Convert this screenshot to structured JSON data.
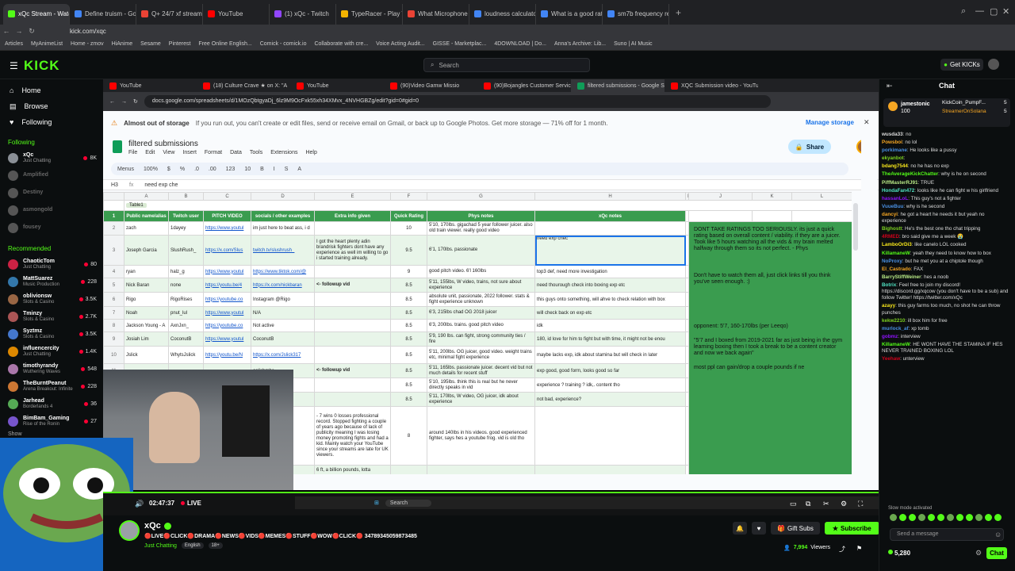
{
  "browser": {
    "tabs": [
      {
        "label": "xQc Stream - Watch Li",
        "color": "#53fc18",
        "active": true
      },
      {
        "label": "Define truism - Google S",
        "color": "#4285f4"
      },
      {
        "label": "Q+ 24/7 xf stream in Ame",
        "color": "#ea4335"
      },
      {
        "label": "YouTube",
        "color": "#ff0000"
      },
      {
        "label": "(1) xQc - Twitch",
        "color": "#9146ff"
      },
      {
        "label": "TypeRacer - Play Typing G",
        "color": "#f4b400"
      },
      {
        "label": "What Microphone Does R",
        "color": "#ea4335"
      },
      {
        "label": "loudness calculator file -",
        "color": "#4285f4"
      },
      {
        "label": "What is a good ratio for v",
        "color": "#4285f4"
      },
      {
        "label": "sm7b frequency response",
        "color": "#4285f4"
      }
    ],
    "url": "kick.com/xqc",
    "bookmarks": [
      "Articles",
      "MyAnimeList",
      "Home - zmov",
      "HiAnime",
      "Sesame",
      "Pinterest",
      "Free Online English...",
      "Comick - comick.io",
      "Collaborate with cre...",
      "Voice Acting Audit...",
      "GISSE - Marketplac...",
      "4DOWNLOAD | Do...",
      "Anna's Archive: Lib...",
      "Suno | AI Music"
    ]
  },
  "kick": {
    "logo": "KICK",
    "search_placeholder": "Search",
    "get_kicks": "Get KICKs"
  },
  "sidebar": {
    "nav": [
      {
        "label": "Home",
        "icon": "home-icon"
      },
      {
        "label": "Browse",
        "icon": "browse-icon"
      },
      {
        "label": "Following",
        "icon": "heart-icon"
      }
    ],
    "following_heading": "Following",
    "following": [
      {
        "name": "xQc",
        "cat": "Just Chatting",
        "viewers": "8K",
        "color": "#8a8f96",
        "live": true
      },
      {
        "name": "Amplified",
        "cat": "",
        "viewers": "",
        "color": "#555",
        "live": false
      },
      {
        "name": "Destiny",
        "cat": "",
        "viewers": "",
        "color": "#555",
        "live": false
      },
      {
        "name": "asmongold",
        "cat": "",
        "viewers": "",
        "color": "#555",
        "live": false
      },
      {
        "name": "fousey",
        "cat": "",
        "viewers": "",
        "color": "#555",
        "live": false
      }
    ],
    "recommended_heading": "Recommended",
    "recommended": [
      {
        "name": "ChaoticTom",
        "cat": "Just Chatting",
        "viewers": "80",
        "color": "#c24"
      },
      {
        "name": "MattSuarez",
        "cat": "Music Production",
        "viewers": "228",
        "color": "#37a"
      },
      {
        "name": "oblivionsw",
        "cat": "Slots & Casino",
        "viewers": "3.5K",
        "color": "#964"
      },
      {
        "name": "Tminzy",
        "cat": "Slots & Casino",
        "viewers": "2.7K",
        "color": "#a55"
      },
      {
        "name": "Syztmz",
        "cat": "Slots & Casino",
        "viewers": "3.5K",
        "color": "#47c"
      },
      {
        "name": "influencercity",
        "cat": "Just Chatting",
        "viewers": "1.4K",
        "color": "#d80"
      },
      {
        "name": "timothyrandy",
        "cat": "Wuthering Waves",
        "viewers": "548",
        "color": "#a7a"
      },
      {
        "name": "TheBurntPeanut",
        "cat": "Arena Breakout: Infinite",
        "viewers": "228",
        "color": "#c73"
      },
      {
        "name": "Jarhead",
        "cat": "Borderlands 4",
        "viewers": "36",
        "color": "#5a5"
      },
      {
        "name": "BimBam_Gaming",
        "cat": "Rise of the Ronin",
        "viewers": "27",
        "color": "#75c"
      }
    ],
    "show_more": "Show"
  },
  "inner_browser": {
    "tabs": [
      "YouTube",
      "(18) Culture Crave ★ on X: \"A",
      "YouTube",
      "(90)Video Gamw Missio",
      "(90)Bojangles Customer Servic",
      "filtered submissions - Google S",
      "XQC Submission video - YouTu"
    ],
    "url": "docs.google.com/spreadsheets/d/1MOzQbtgyaDj_6lz9M9OcFxk55xh34XMvx_4NVHGBZg/edit?gid=0#gid=0"
  },
  "docs": {
    "banner_title": "Almost out of storage",
    "banner_body": "If you run out, you can't create or edit files, send or receive email on Gmail, or back up to Google Photos. Get more storage — 71% off for 1 month.",
    "manage_storage": "Manage storage",
    "title": "filtered submissions",
    "menu": [
      "File",
      "Edit",
      "View",
      "Insert",
      "Format",
      "Data",
      "Tools",
      "Extensions",
      "Help"
    ],
    "share": "Share",
    "toolbar": [
      "Menus",
      "100%",
      "$",
      "%",
      ".0",
      ".00",
      "123",
      "10",
      "B",
      "I",
      "S",
      "A"
    ],
    "name_box": "H3",
    "formula": "need exp che",
    "table_name": "Table1"
  },
  "sheet": {
    "cols": [
      "",
      "A",
      "B",
      "C",
      "D",
      "E",
      "F",
      "G",
      "H",
      "I",
      "J",
      "K",
      "L"
    ],
    "headers": [
      "Public name/alias",
      "Twitch user",
      "PITCH VIDEO",
      "socials / other examples",
      "Extra info given",
      "Quick Rating",
      "Phys notes",
      "xQc notes"
    ],
    "rows": [
      {
        "n": "2",
        "a": "zach",
        "b": "1dayey",
        "c": "https://www.youtul",
        "d": "im just here to beat ass, i d",
        "e": "",
        "f": "10",
        "g": "5'10, 170lbs. gigachad 5 year follower juicer. also old train viewer. really good video",
        "h": ""
      },
      {
        "n": "3",
        "a": "Joseph Garcia",
        "b": "SlushRush_",
        "c": "https://x.com/Slus",
        "d": "twitch.tv/slushrush_",
        "e": "I got the heart plenty adin brandrisk fighters dont have any experience as well im willing to go i started training already.",
        "f": "9.5",
        "g": "6'1, 170lbs. passionate",
        "h": "need exp chec"
      },
      {
        "n": "4",
        "a": "ryan",
        "b": "halz_g",
        "c": "https://www.youtul",
        "d": "https://www.tiktok.com/@",
        "e": "",
        "f": "9",
        "g": "good pitch video. 6'l 160lbs",
        "h": "top3 def, need more investigation"
      },
      {
        "n": "5",
        "a": "Nick Baran",
        "b": "none",
        "c": "https://youtu.be/4",
        "d": "https://x.com/nickbaran",
        "e": "<- followup vid",
        "f": "8.5",
        "g": "5'11, 155lbs, W video, trains, not sure about experience",
        "h": "need thourough check into boxing exp etc"
      },
      {
        "n": "6",
        "a": "Rigo",
        "b": "RigoRises",
        "c": "https://youtube.co",
        "d": "Instagram @Rigo",
        "e": "",
        "f": "8.5",
        "g": "absolute unit, passionate, 2022 follower. stats & fight experience unknown",
        "h": "this guys onto something, will ahve to check relation with box"
      },
      {
        "n": "7",
        "a": "Noah",
        "b": "pnut_lul",
        "c": "https://www.youtul",
        "d": "N/A",
        "e": "",
        "f": "8.5",
        "g": "6'3, 215lbs chad OG 2018 juicer",
        "h": "will check back on exp etc"
      },
      {
        "n": "8",
        "a": "Jackson Young - A",
        "b": "AxnJxn_",
        "c": "https://youtube.co",
        "d": "Not active",
        "e": "",
        "f": "8.5",
        "g": "6'3, 200lbs. trains. good pitch video",
        "h": "idk"
      },
      {
        "n": "9",
        "a": "Josiah Lim",
        "b": "CoconutB",
        "c": "https://www.youtul",
        "d": "CoconutB",
        "e": "",
        "f": "8.5",
        "g": "5'9, 190 lbs. can fight, strong community ties / fire",
        "h": "180, id love for him to fight but with time, it might not be enou"
      },
      {
        "n": "10",
        "a": "Jslick",
        "b": "WhytsJslick",
        "c": "https://youtu.be/N",
        "d": "https://x.com/Jslick317",
        "e": "",
        "f": "8.5",
        "g": "5'11, 200lbs. OG juicer, good video. weight trains etc, minimal fight experience",
        "h": "maybe lacks exp, idk about stamina but will check in later"
      },
      {
        "n": "11",
        "a": "",
        "b": "",
        "c": "",
        "d": "calishmbe",
        "e": "<- followup vid",
        "f": "8.5",
        "g": "5'11, 165lbs. passionate juicer. decent vid but not much details for recent stuff",
        "h": "exp good, good form, looks good so far"
      },
      {
        "n": "12",
        "a": "",
        "b": "",
        "c": "",
        "d": "",
        "e": "",
        "f": "8.5",
        "g": "5'10, 195lbs. think this is real but he never directly speaks in vid",
        "h": "experience ? training ? idk,. content tho"
      },
      {
        "n": "13",
        "a": "",
        "b": "",
        "c": "",
        "d": "/jean_T",
        "e": "",
        "f": "8.5",
        "g": "5'11, 170lbs, W video, OG juicer, idk about experience",
        "h": "not bad, experience?"
      },
      {
        "n": "14",
        "a": "",
        "b": "",
        "c": "",
        "d": "sHE7KxM",
        "e": "- 7 wins 0 losses professional record. Stopped fighting a couple of years ago because of lack of publicity meaning I was losing money promoting fights and had a kid. Mainly watch your YouTube since your streams are late for UK viewers.",
        "f": "8",
        "g": "around 140lbs in his videos. good experienced fighter, says hes a youtube frog. vid is old tho",
        "h": ""
      },
      {
        "n": "15",
        "a": "",
        "b": "",
        "c": "",
        "d": "",
        "e": "6 ft, a billion pounds, lotta",
        "f": "",
        "g": "",
        "h": ""
      }
    ],
    "note1": "DONT TAKE RATINGS TOO SERIOUSLY. its just a quick rating based on overall content / viability. if they are a juicer. Took like 5 hours watching all the vids & my brain melted halfway through them so its not perfect. - Phys",
    "note2": "Don't have to watch them all, just click links till you think you've seen enough. :)",
    "note3": "opponent: 5'7, 160-170lbs (per Leeqo)",
    "note4": "\"5'7 and I boxed from 2019-2021 far as just being in the gym learning boxing then I took a break to be a content creator and now we back again\"",
    "note5": "most ppl can gain/drop a couple pounds if ne"
  },
  "player": {
    "time": "02:47:37",
    "live": "LIVE",
    "taskbar_search": "Search"
  },
  "streamer": {
    "name": "xQc",
    "title": "🔴LIVE🔴CLICK🔴DRAMA🔴NEWS🔴VIDS🔴MEMES🔴STUFF🔴WOW🔴CLICK🔴 34789345059873485",
    "category": "Just Chatting",
    "tags": [
      "English",
      "18+"
    ],
    "gift_subs": "Gift Subs",
    "subscribe": "Subscribe",
    "viewers": "7,994",
    "viewers_label": "Viewers",
    "uptime": "2:47:37"
  },
  "chat": {
    "title": "Chat",
    "pinned_user": "jamestonic",
    "pinned_sub": "100",
    "pinned_right1": "KickCoin_PumpF...",
    "pinned_right2": "StreamerOnSolana",
    "pinned_n1": "5",
    "pinned_n2": "5",
    "messages": [
      {
        "u": "wusda33",
        "c": "#ddd",
        "t": "no"
      },
      {
        "u": "Powsboi",
        "c": "#f5a623",
        "t": "no lol"
      },
      {
        "u": "porkimane",
        "c": "#4a90e2",
        "t": "He looks like a pussy"
      },
      {
        "u": "ekyanbot",
        "c": "#7ed321",
        "t": ""
      },
      {
        "u": "bdang7544",
        "c": "#f8e71c",
        "t": "no he has no exp"
      },
      {
        "u": "TheAverageKickChatter",
        "c": "#53fc18",
        "t": "why is he on second"
      },
      {
        "u": "PiffMasterRJ91",
        "c": "#b8e986",
        "t": "TRUE"
      },
      {
        "u": "HondaFan472",
        "c": "#50e3c2",
        "t": "looks like he can fight w his girlfriend"
      },
      {
        "u": "hassanLoL",
        "c": "#9013fe",
        "t": "This guy's not a fighter"
      },
      {
        "u": "VuueBuu",
        "c": "#4a90e2",
        "t": "why is he second"
      },
      {
        "u": "dancyi",
        "c": "#f5a623",
        "t": "he got a heart he needs it but yeah no experience"
      },
      {
        "u": "Bighostt",
        "c": "#7ed321",
        "t": "He's the best one tho chat tripping"
      },
      {
        "u": "4RMED",
        "c": "#d0021b",
        "t": "bro said give me a week 😭"
      },
      {
        "u": "LamboOrDi3",
        "c": "#f8e71c",
        "t": "like canelo LOL cooked"
      },
      {
        "u": "KillamaneW",
        "c": "#53fc18",
        "t": "yeah they need to know how to box"
      },
      {
        "u": "NoProxy",
        "c": "#4a90e2",
        "t": "but he met you at a chiptole though"
      },
      {
        "u": "El_Castrado",
        "c": "#f5a623",
        "t": "FAX"
      },
      {
        "u": "BarryStiffWeiner",
        "c": "#b8e986",
        "t": "hes a noob"
      },
      {
        "u": "Botrix",
        "c": "#50e3c2",
        "t": "Feel free to join my discord! https://discord.gg/xqcow (you don't have to be a sub) and follow Twitter! https://twitter.com/xQc"
      },
      {
        "u": "azayy",
        "c": "#f8e71c",
        "t": "this guy farms too much, no shot he can throw punches"
      },
      {
        "u": "kekw2210",
        "c": "#7ed321",
        "t": "ill box him for free"
      },
      {
        "u": "murlock_af",
        "c": "#4a90e2",
        "t": "xp tomb"
      },
      {
        "u": "gobmz",
        "c": "#9013fe",
        "t": "interview"
      },
      {
        "u": "KillamaneW",
        "c": "#53fc18",
        "t": "HE WONT HAVE THE STAMINA IF HES NEVER TRAINED BOXING LOL"
      },
      {
        "u": "Yeehaw",
        "c": "#d0021b",
        "t": "unterview"
      }
    ],
    "slow_mode": "Slow mode activated",
    "input_placeholder": "Send a message",
    "points": "5,280",
    "chat_button": "Chat"
  }
}
